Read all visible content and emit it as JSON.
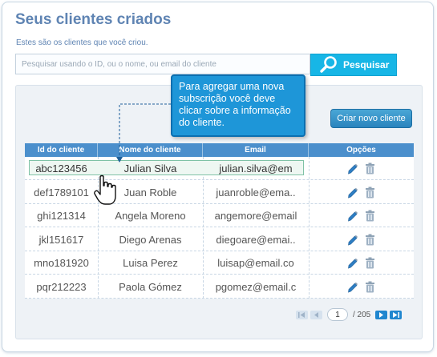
{
  "page": {
    "title": "Seus clientes criados",
    "subtitle": "Estes são os clientes que você criou."
  },
  "search": {
    "placeholder": "Pesquisar usando o ID, ou o nome, ou email do cliente",
    "button_label": "Pesquisar"
  },
  "tooltip": {
    "text": "Para agregar uma nova subscrição você deve clicar sobre a informação do cliente."
  },
  "new_client_button": "Criar novo cliente",
  "table": {
    "columns": [
      "Id do cliente",
      "Nome do cliente",
      "Email",
      "Opções"
    ],
    "rows": [
      {
        "id": "abc123456",
        "name": "Julian Silva",
        "email": "julian.silva@em"
      },
      {
        "id": "def1789101",
        "name": "Juan Roble",
        "email": "juanroble@ema.."
      },
      {
        "id": "ghi121314",
        "name": "Angela Moreno",
        "email": "angemore@email"
      },
      {
        "id": "jkl151617",
        "name": "Diego Arenas",
        "email": "diegoare@emai.."
      },
      {
        "id": "mno181920",
        "name": "Luisa Perez",
        "email": "luisap@email.co"
      },
      {
        "id": "pqr212223",
        "name": "Paola Gómez",
        "email": "pgomez@email.c"
      }
    ],
    "selected_row": 0,
    "row_actions": [
      "pencil-icon",
      "trash-icon"
    ]
  },
  "pagination": {
    "current_page": "1",
    "total": "/ 205"
  },
  "colors": {
    "title": "#5f84b3",
    "search_button": "#17b6e6",
    "tooltip": "#1e96d8",
    "table_header": "#4b8fcc",
    "new_client_button": "#2a84bd"
  }
}
